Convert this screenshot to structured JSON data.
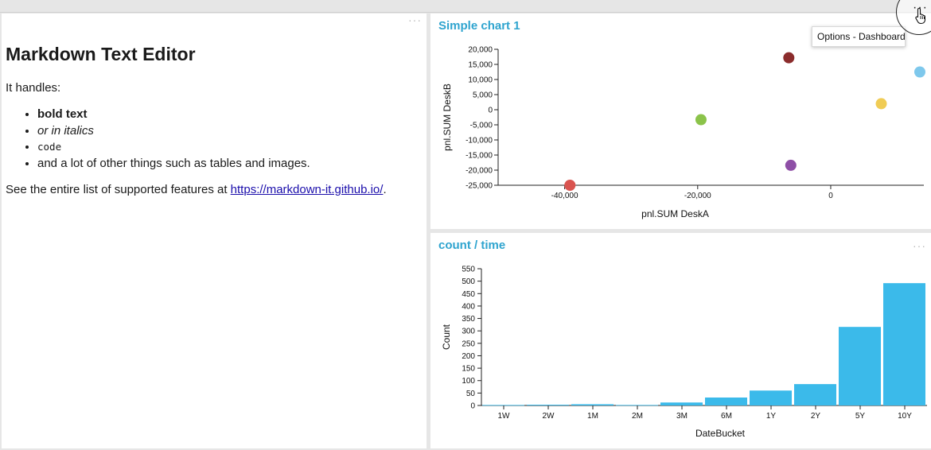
{
  "markdown_panel": {
    "menu_icon": "more-dots-icon",
    "heading": "Markdown Text Editor",
    "intro": "It handles:",
    "list": {
      "bold": "bold text",
      "italic": "or in italics",
      "code": "code",
      "other": "and a lot of other things such as tables and images."
    },
    "footer_prefix": "See the entire list of supported features at ",
    "footer_link": "https://markdown-it.github.io/",
    "footer_suffix": "."
  },
  "scatter_panel": {
    "title": "Simple chart 1",
    "menu_icon": "more-dots-icon"
  },
  "bar_panel": {
    "title": "count / time",
    "menu_icon": "more-dots-icon"
  },
  "tooltip": {
    "text": "Options - Dashboard"
  },
  "options_button": {
    "icon": "more-dots-icon",
    "cursor_icon": "hand-pointer-icon"
  },
  "colors": {
    "accent": "#2fa4cf",
    "bar": "#3bbaea"
  },
  "chart_data": [
    {
      "type": "scatter",
      "xlabel": "pnl.SUM DeskA",
      "ylabel": "pnl.SUM DeskB",
      "xlim": [
        -50000,
        14000
      ],
      "ylim": [
        -25000,
        20000
      ],
      "xticks": [
        -40000,
        -20000,
        0
      ],
      "xtick_labels": [
        "-40,000",
        "-20,000",
        "0"
      ],
      "yticks": [
        20000,
        15000,
        10000,
        5000,
        0,
        -5000,
        -10000,
        -15000,
        -20000,
        -25000
      ],
      "ytick_labels": [
        "20,000",
        "15,000",
        "10,000",
        "5,000",
        "0",
        "-5,000",
        "-10,000",
        "-15,000",
        "-20,000",
        "-25,000"
      ],
      "points": [
        {
          "x": -39200,
          "y": -25000,
          "color": "#d9534f"
        },
        {
          "x": -19500,
          "y": -3300,
          "color": "#8bc34a"
        },
        {
          "x": -6300,
          "y": 17200,
          "color": "#8b2c2c"
        },
        {
          "x": -6000,
          "y": -18400,
          "color": "#8e4fa6"
        },
        {
          "x": 7600,
          "y": 2000,
          "color": "#f0cc55"
        },
        {
          "x": 13400,
          "y": 12500,
          "color": "#7ec8ec"
        }
      ]
    },
    {
      "type": "bar",
      "xlabel": "DateBucket",
      "ylabel": "Count",
      "ylim": [
        0,
        550
      ],
      "yticks": [
        0,
        50,
        100,
        150,
        200,
        250,
        300,
        350,
        400,
        450,
        500,
        550
      ],
      "categories": [
        "1W",
        "2W",
        "1M",
        "2M",
        "3M",
        "6M",
        "1Y",
        "2Y",
        "5Y",
        "10Y"
      ],
      "values": [
        2,
        3,
        5,
        2,
        12,
        32,
        60,
        86,
        316,
        492
      ]
    }
  ]
}
